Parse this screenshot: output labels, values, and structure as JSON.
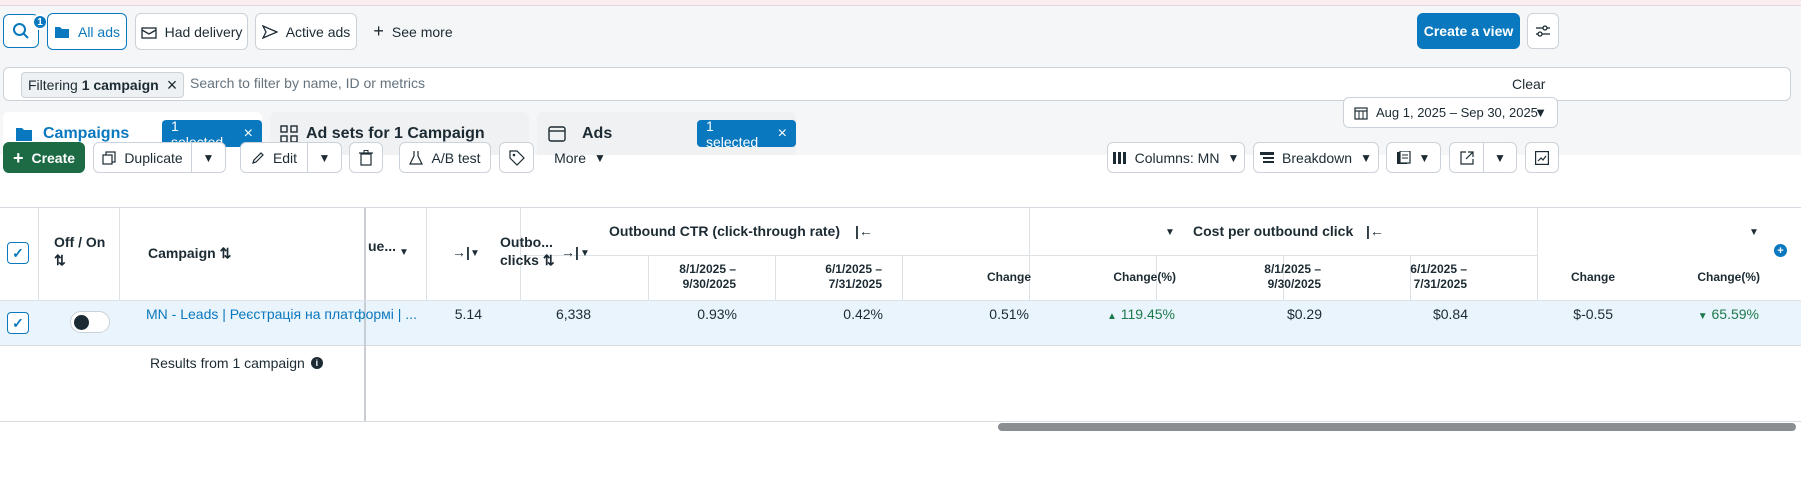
{
  "header": {
    "search_badge": "1",
    "filters": [
      {
        "label": "All ads",
        "icon": "folder-icon"
      },
      {
        "label": "Had delivery",
        "icon": "envelope-icon"
      },
      {
        "label": "Active ads",
        "icon": "send-icon"
      }
    ],
    "see_more": "See more",
    "create_view": "Create a view"
  },
  "filter_bar": {
    "chip_prefix": "Filtering",
    "chip_bold": "1 campaign",
    "placeholder": "Search to filter by name, ID or metrics",
    "clear": "Clear"
  },
  "tabs": [
    {
      "label": "Campaigns",
      "selected_pill": "1 selected"
    },
    {
      "label": "Ad sets for 1 Campaign"
    },
    {
      "label": "Ads",
      "selected_pill": "1 selected"
    }
  ],
  "date_range": "Aug 1, 2025 – Sep 30, 2025",
  "toolbar": {
    "create": "Create",
    "duplicate": "Duplicate",
    "edit": "Edit",
    "ab_test": "A/B test",
    "more": "More",
    "columns": "Columns: MN",
    "breakdown": "Breakdown"
  },
  "table": {
    "col_off_on": "Off / On",
    "col_campaign": "Campaign",
    "col_partial": "ue...",
    "col_outbound_clicks_1": "Outbo...",
    "col_outbound_clicks_2": "clicks",
    "group_ctr": "Outbound CTR (click-through rate)",
    "group_cpc": "Cost per outbound click",
    "sub_current_1": "8/1/2025 –",
    "sub_current_2": "9/30/2025",
    "sub_prev_1": "6/1/2025 –",
    "sub_prev_2": "7/31/2025",
    "sub_change": "Change",
    "sub_change_pct": "Change(%)",
    "row": {
      "campaign_name": "MN - Leads | Реєстрація на платформі | ...",
      "partial_value": "5.14",
      "outbound_clicks": "6,338",
      "ctr_current": "0.93%",
      "ctr_prev": "0.42%",
      "ctr_change": "0.51%",
      "ctr_change_pct": "119.45%",
      "cpc_current": "$0.29",
      "cpc_prev": "$0.84",
      "cpc_change": "$-0.55",
      "cpc_change_pct": "65.59%"
    },
    "results_label": "Results from 1 campaign"
  }
}
